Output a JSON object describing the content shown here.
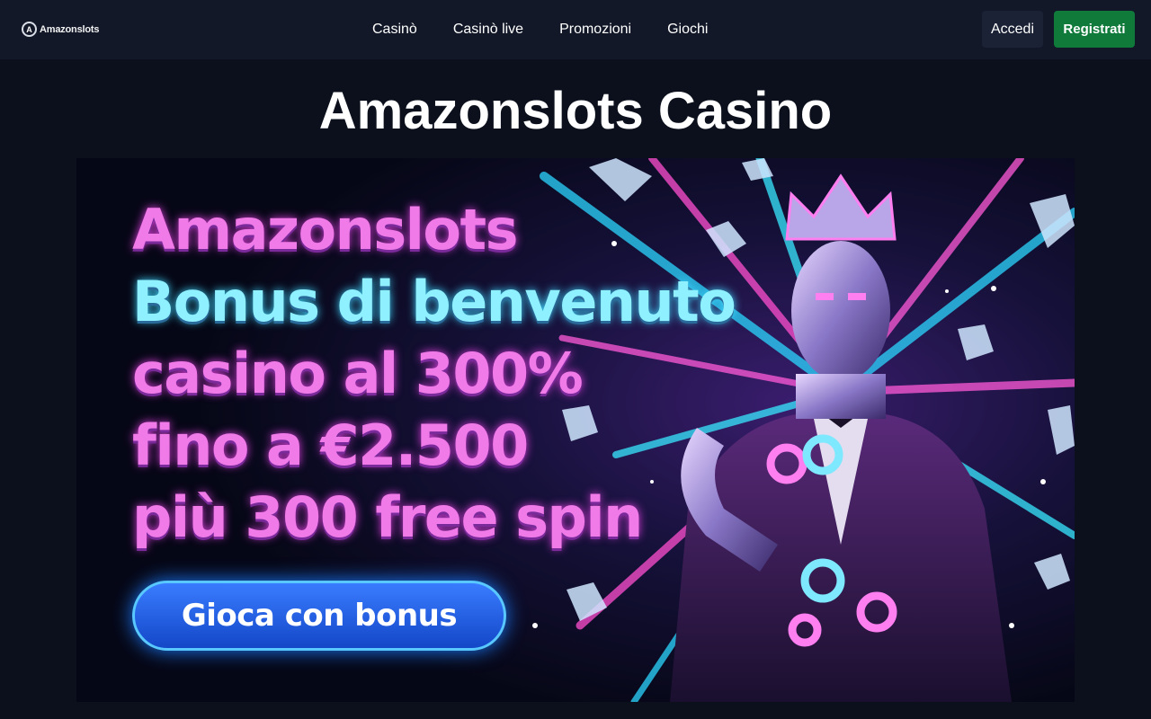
{
  "header": {
    "logo_mark": "A",
    "logo_text": "Amazonslots",
    "nav": [
      "Casinò",
      "Casinò live",
      "Promozioni",
      "Giochi"
    ],
    "login_label": "Accedi",
    "register_label": "Registrati"
  },
  "main": {
    "title": "Amazonslots Casino",
    "banner": {
      "line1": "Amazonslots",
      "line2": "Bonus di benvenuto",
      "line3": "casino al 300%",
      "line4": "fino a €2.500",
      "line5": "più 300 free spin",
      "cta_label": "Gioca con bonus"
    }
  },
  "colors": {
    "background": "#0b101c",
    "header": "#121828",
    "register": "#0f7a3a",
    "pink_text": "#f07ae8",
    "cyan_text": "#8ff0ff",
    "cta": "#1b5cf0"
  }
}
